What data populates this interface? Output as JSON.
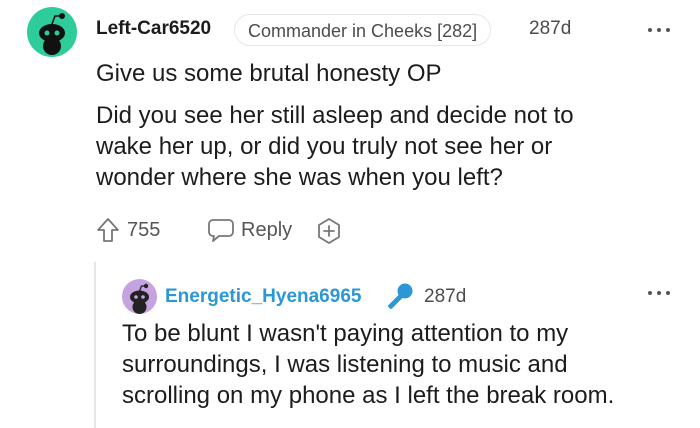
{
  "comment": {
    "username": "Left-Car6520",
    "flair": "Commander in Cheeks [282]",
    "time": "287d",
    "lines": [
      "Give us some brutal honesty OP",
      "Did you see her still asleep and decide not to",
      "wake her up, or did you truly not see her or",
      "wonder where she was when you left?"
    ],
    "upvotes": "755",
    "reply_label": "Reply"
  },
  "reply": {
    "username": "Energetic_Hyena6965",
    "time": "287d",
    "lines": [
      "To be blunt I wasn't paying attention to my",
      "surroundings, I was listening to music and",
      "scrolling on my phone as I left the break room."
    ]
  },
  "colors": {
    "avatar_main": "#2ecc9a",
    "avatar_reply": "#c5a3e0",
    "reply_username": "#2b97d6",
    "mic_icon": "#2b97d6"
  },
  "icons": [
    "snoo-avatar-icon",
    "more-options-icon",
    "upvote-arrow-icon",
    "comment-bubble-icon",
    "award-plus-icon",
    "microphone-icon"
  ]
}
